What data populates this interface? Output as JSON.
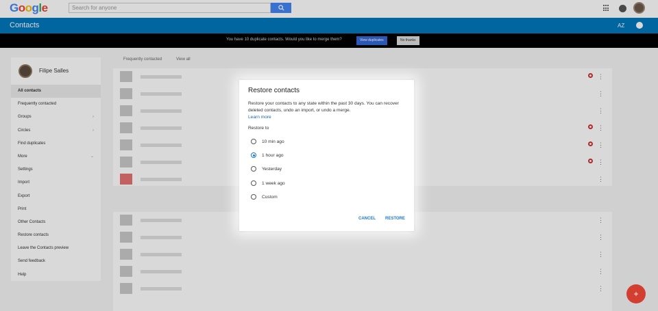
{
  "google": {
    "logo_letters": [
      "G",
      "o",
      "o",
      "g",
      "l",
      "e"
    ],
    "search_placeholder": "Search for anyone"
  },
  "contacts_bar": {
    "title": "Contacts",
    "sort_label": "AZ"
  },
  "banner": {
    "message": "You have 10 duplicate contacts. Would you like to merge them?",
    "view_duplicates": "View duplicates",
    "no_thanks": "No thanks"
  },
  "sidebar": {
    "user_name": "Filipe Salles",
    "items": [
      {
        "label": "All contacts"
      },
      {
        "label": "Frequently contacted"
      },
      {
        "label": "Groups"
      },
      {
        "label": "Circles"
      },
      {
        "label": "Find duplicates"
      },
      {
        "label": "More"
      },
      {
        "label": "Settings"
      },
      {
        "label": "Import"
      },
      {
        "label": "Export"
      },
      {
        "label": "Print"
      },
      {
        "label": "Other Contacts"
      },
      {
        "label": "Restore contacts"
      },
      {
        "label": "Leave the Contacts preview"
      },
      {
        "label": "Send feedback"
      },
      {
        "label": "Help"
      }
    ]
  },
  "content": {
    "frequently_contacted": "Frequently contacted",
    "view_all": "View all"
  },
  "dialog": {
    "title": "Restore contacts",
    "description": "Restore your contacts to any state within the past 30 days. You can recover deleted contacts, undo an import, or undo a merge.",
    "learn_more": "Learn more",
    "restore_to": "Restore to",
    "options": [
      {
        "label": "10 min ago",
        "selected": false
      },
      {
        "label": "1 hour ago",
        "selected": true
      },
      {
        "label": "Yesterday",
        "selected": false
      },
      {
        "label": "1 week ago",
        "selected": false
      },
      {
        "label": "Custom",
        "selected": false
      }
    ],
    "cancel": "CANCEL",
    "restore": "RESTORE"
  },
  "fab_icon": "add-person-icon",
  "colors": {
    "accent": "#0277bd",
    "link": "#1976d2",
    "fab": "#d23f31"
  }
}
